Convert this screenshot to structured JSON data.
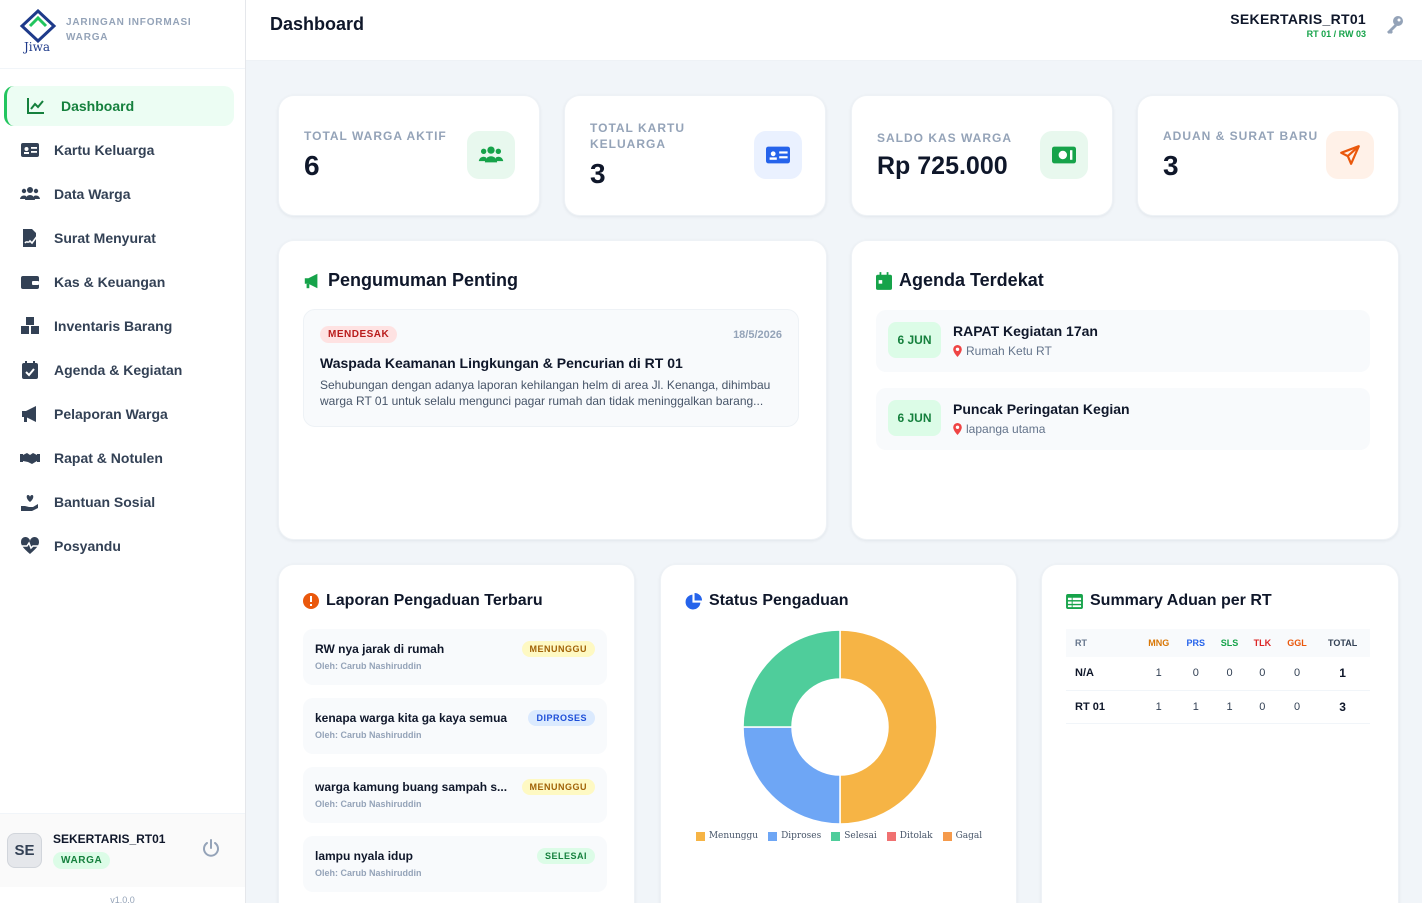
{
  "app": {
    "name": "Jiwa",
    "tagline": "JARINGAN INFORMASI WARGA",
    "version": "v1.0.0"
  },
  "sidebar": {
    "items": [
      {
        "label": "Dashboard",
        "icon": "chart-line-icon"
      },
      {
        "label": "Kartu Keluarga",
        "icon": "id-card-icon"
      },
      {
        "label": "Data Warga",
        "icon": "users-icon"
      },
      {
        "label": "Surat Menyurat",
        "icon": "file-signature-icon"
      },
      {
        "label": "Kas & Keuangan",
        "icon": "wallet-icon"
      },
      {
        "label": "Inventaris Barang",
        "icon": "boxes-icon"
      },
      {
        "label": "Agenda & Kegiatan",
        "icon": "calendar-check-icon"
      },
      {
        "label": "Pelaporan Warga",
        "icon": "bullhorn-icon"
      },
      {
        "label": "Rapat & Notulen",
        "icon": "handshake-icon"
      },
      {
        "label": "Bantuan Sosial",
        "icon": "hand-holding-heart-icon"
      },
      {
        "label": "Posyandu",
        "icon": "heart-pulse-icon"
      }
    ]
  },
  "user": {
    "initials": "SE",
    "name": "SEKERTARIS_RT01",
    "role": "WARGA",
    "scope": "RT 01 / RW 03"
  },
  "header": {
    "title": "Dashboard"
  },
  "stats": [
    {
      "label": "TOTAL WARGA AKTIF",
      "value": "6",
      "icon": "users-icon",
      "color": "#16a34a"
    },
    {
      "label": "TOTAL KARTU KELUARGA",
      "value": "3",
      "icon": "id-card-icon",
      "color": "#2563eb"
    },
    {
      "label": "SALDO KAS WARGA",
      "value": "Rp 725.000",
      "icon": "money-bill-icon",
      "color": "#16a34a"
    },
    {
      "label": "ADUAN & SURAT BARU",
      "value": "3",
      "icon": "paper-plane-icon",
      "color": "#ea580c"
    }
  ],
  "announcements": {
    "title": "Pengumuman Penting",
    "items": [
      {
        "badge": "MENDESAK",
        "date": "18/5/2026",
        "title": "Waspada Keamanan Lingkungan & Pencurian di RT 01",
        "body": "Sehubungan dengan adanya laporan kehilangan helm di area Jl. Kenanga, dihimbau warga RT 01 untuk selalu mengunci pagar rumah dan tidak meninggalkan barang..."
      }
    ]
  },
  "agenda": {
    "title": "Agenda Terdekat",
    "items": [
      {
        "date": "6 JUN",
        "title": "RAPAT Kegiatan 17an",
        "location": "Rumah Ketu RT"
      },
      {
        "date": "6 JUN",
        "title": "Puncak Peringatan Kegian",
        "location": "lapanga utama"
      }
    ]
  },
  "reports": {
    "title": "Laporan Pengaduan Terbaru",
    "items": [
      {
        "title": "RW nya jarak di rumah",
        "by": "Oleh: Carub Nashiruddin",
        "status": "MENUNGGU"
      },
      {
        "title": "kenapa warga kita ga kaya semua",
        "by": "Oleh: Carub Nashiruddin",
        "status": "DIPROSES"
      },
      {
        "title": "warga kamung buang sampah s...",
        "by": "Oleh: Carub Nashiruddin",
        "status": "MENUNGGU"
      },
      {
        "title": "lampu nyala idup",
        "by": "Oleh: Carub Nashiruddin",
        "status": "SELESAI"
      }
    ]
  },
  "status_chart": {
    "title": "Status Pengaduan"
  },
  "chart_data": {
    "type": "pie",
    "donut": true,
    "categories": [
      "Menunggu",
      "Diproses",
      "Selesai",
      "Ditolak",
      "Gagal"
    ],
    "values": [
      2,
      1,
      1,
      0,
      0
    ],
    "colors": [
      "#f6b445",
      "#6ea6f5",
      "#4fcd9b",
      "#f07171",
      "#f59a4b"
    ],
    "legend": "bottom"
  },
  "summary": {
    "title": "Summary Aduan per RT",
    "columns": [
      "RT",
      "MNG",
      "PRS",
      "SLS",
      "TLK",
      "GGL",
      "TOTAL"
    ],
    "column_colors": [
      "#64748b",
      "#d97706",
      "#2563eb",
      "#16a34a",
      "#dc2626",
      "#ea580c",
      "#334155"
    ],
    "rows": [
      [
        "N/A",
        "1",
        "0",
        "0",
        "0",
        "0",
        "1"
      ],
      [
        "RT 01",
        "1",
        "1",
        "1",
        "0",
        "0",
        "3"
      ]
    ]
  }
}
